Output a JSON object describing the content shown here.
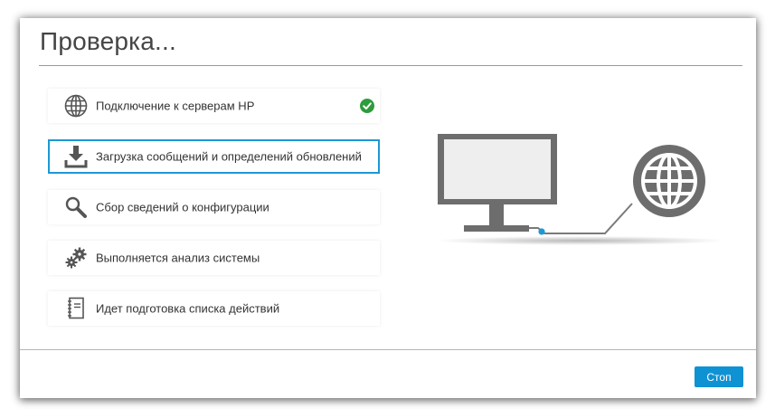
{
  "dialog": {
    "title": "Проверка...",
    "steps": [
      {
        "label": "Подключение к серверам HP",
        "icon": "globe-icon",
        "status": "done"
      },
      {
        "label": "Загрузка сообщений и определений обновлений",
        "icon": "download-icon",
        "status": "active"
      },
      {
        "label": "Сбор сведений о конфигурации",
        "icon": "magnifier-icon",
        "status": "pending"
      },
      {
        "label": "Выполняется анализ системы",
        "icon": "gears-icon",
        "status": "pending"
      },
      {
        "label": "Идет подготовка списка действий",
        "icon": "notebook-icon",
        "status": "pending"
      }
    ],
    "stop_label": "Стоп"
  },
  "colors": {
    "accent": "#1e98d4",
    "button": "#0f92d4",
    "check": "#2e9c3d",
    "icon": "#555555"
  }
}
